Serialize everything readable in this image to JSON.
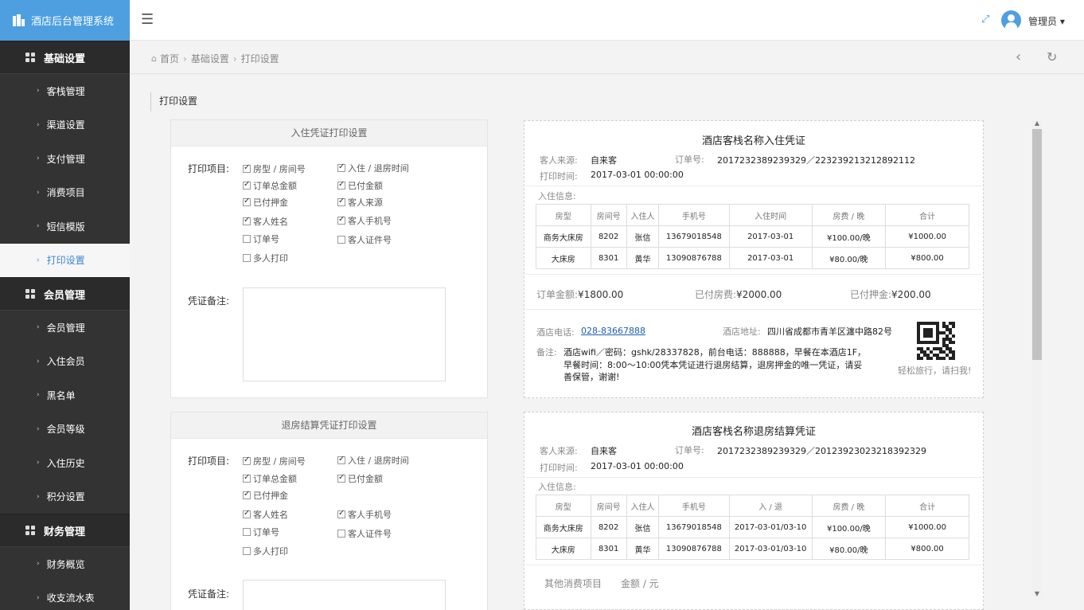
{
  "app": {
    "title": "酒店后台管理系统"
  },
  "topbar": {
    "user": "管理员 ▾"
  },
  "sidebar": {
    "groups": [
      {
        "label": "基础设置",
        "items": [
          "客栈管理",
          "渠道设置",
          "支付管理",
          "消费项目",
          "短信模版",
          "打印设置"
        ]
      },
      {
        "label": "会员管理",
        "items": [
          "会员管理",
          "入住会员",
          "黑名单",
          "会员等级",
          "入住历史",
          "积分设置"
        ]
      },
      {
        "label": "财务管理",
        "items": [
          "财务概览",
          "收支流水表"
        ]
      }
    ],
    "active": "打印设置"
  },
  "breadcrumb": {
    "home": "首页",
    "level1": "基础设置",
    "level2": "打印设置"
  },
  "page_title": "打印设置",
  "checkin_settings": {
    "header": "入住凭证打印设置",
    "items_label": "打印项目:",
    "items": [
      {
        "label": "房型 / 房间号",
        "checked": true
      },
      {
        "label": "入住 / 退房时间",
        "checked": true
      },
      {
        "label": "订单总金额",
        "checked": true
      },
      {
        "label": "已付金额",
        "checked": true
      },
      {
        "label": "已付押金",
        "checked": true
      },
      {
        "label": "客人来源",
        "checked": true
      },
      {
        "label": "客人姓名",
        "checked": true
      },
      {
        "label": "客人手机号",
        "checked": true
      },
      {
        "label": "订单号",
        "checked": false
      },
      {
        "label": "客人证件号",
        "checked": false
      },
      {
        "label": "多人打印",
        "checked": false
      }
    ],
    "remark_label": "凭证备注:"
  },
  "checkout_settings": {
    "header": "退房结算凭证打印设置",
    "items_label": "打印项目:",
    "items": [
      {
        "label": "房型 / 房间号",
        "checked": true
      },
      {
        "label": "入住 / 退房时间",
        "checked": true
      },
      {
        "label": "订单总金额",
        "checked": true
      },
      {
        "label": "已付金额",
        "checked": true
      },
      {
        "label": "已付押金",
        "checked": true
      },
      {
        "label": "客人姓名",
        "checked": true
      },
      {
        "label": "客人手机号",
        "checked": true
      },
      {
        "label": "订单号",
        "checked": false
      },
      {
        "label": "客人证件号",
        "checked": false
      },
      {
        "label": "多人打印",
        "checked": false
      }
    ],
    "remark_label": "凭证备注:"
  },
  "checkin_voucher": {
    "title": "酒店客栈名称入住凭证",
    "source_label": "客人来源:",
    "source": "自来客",
    "order_label": "订单号:",
    "order": "2017232389239329／223239213212892112",
    "time_label": "打印时间:",
    "time": "2017-03-01 00:00:00",
    "info_label": "入住信息:",
    "columns": [
      "房型",
      "房间号",
      "入住人",
      "手机号",
      "入住时间",
      "房费 / 晚",
      "合计"
    ],
    "rows": [
      [
        "商务大床房",
        "8202",
        "张信",
        "13679018548",
        "2017-03-01",
        "¥100.00/晚",
        "¥1000.00"
      ],
      [
        "大床房",
        "8301",
        "黄华",
        "13090876788",
        "2017-03-01",
        "¥80.00/晚",
        "¥800.00"
      ]
    ],
    "order_amount_label": "订单金额:",
    "order_amount": "¥1800.00",
    "paid_room_label": "已付房费:",
    "paid_room": "¥2000.00",
    "paid_deposit_label": "已付押金:",
    "paid_deposit": "¥200.00",
    "phone_label": "酒店电话:",
    "phone": "028-83667888",
    "address_label": "酒店地址:",
    "address": "四川省成都市青羊区瀍中路82号",
    "remark_label": "备注:",
    "remark_line1": "酒店wifi／密码：gshk/28337828，前台电话：888888，早餐在本酒店1F，",
    "remark_line2": "早餐时间：8:00～10:00凭本凭证进行退房结算，退房押金的唯一凭证，请妥",
    "remark_line3": "善保管，谢谢!",
    "qr_caption": "轻松旅行，请扫我!"
  },
  "checkout_voucher": {
    "title": "酒店客栈名称退房结算凭证",
    "source_label": "客人来源:",
    "source": "自来客",
    "order_label": "订单号:",
    "order": "2017232389239329／201239230232183923​29",
    "time_label": "打印时间:",
    "time": "2017-03-01 00:00:00",
    "info_label": "入住信息:",
    "columns": [
      "房型",
      "房间号",
      "入住人",
      "手机号",
      "入 / 退",
      "房费 / 晚",
      "合计"
    ],
    "rows": [
      [
        "商务大床房",
        "8202",
        "张信",
        "13679018548",
        "2017-03-01/03-10",
        "¥100.00/晚",
        "¥1000.00"
      ],
      [
        "大床房",
        "8301",
        "黄华",
        "13090876788",
        "2017-03-01/03-10",
        "¥80.00/晚",
        "¥800.00"
      ]
    ],
    "other_label": "其他消费项目",
    "amount_label": "金额 / 元"
  }
}
